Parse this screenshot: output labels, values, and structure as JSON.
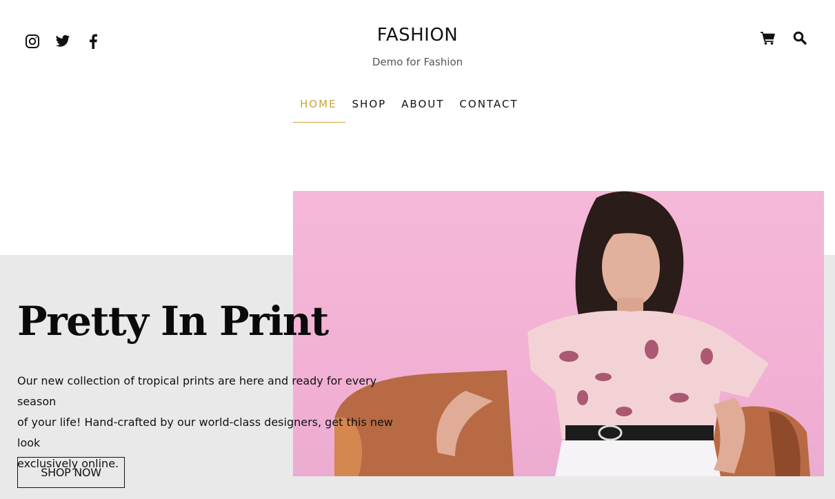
{
  "header": {
    "site_title": "FASHION",
    "site_description": "Demo for Fashion",
    "social_icons": [
      "instagram-icon",
      "twitter-icon",
      "facebook-icon"
    ],
    "utility_icons": [
      "cart-icon",
      "search-icon"
    ]
  },
  "nav": {
    "items": [
      {
        "label": "HOME",
        "active": true
      },
      {
        "label": "SHOP",
        "active": false
      },
      {
        "label": "ABOUT",
        "active": false
      },
      {
        "label": "CONTACT",
        "active": false
      }
    ]
  },
  "hero": {
    "title": "Pretty In Print",
    "description_lines": [
      "Our new collection of tropical prints are here and ready for every season",
      "of your life! Hand-crafted by our world-class designers, get this new look",
      "exclusively online."
    ],
    "button_label": "SHOP NOW"
  },
  "colors": {
    "accent": "#c9a33a",
    "hero_band": "#e9e9e9",
    "image_background": "#f5b8d8"
  }
}
